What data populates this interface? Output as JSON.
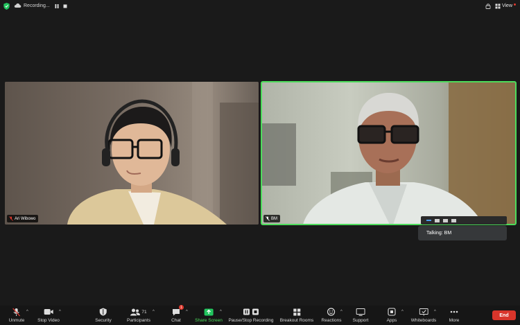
{
  "topbar": {
    "recording_label": "Recording...",
    "view_label": "View"
  },
  "participants": [
    {
      "name": "Ari Wibowo",
      "muted": true
    },
    {
      "name": "BM",
      "muted": true,
      "active_speaker": true
    }
  ],
  "talking": {
    "label": "Talking: BM"
  },
  "toolbar": {
    "unmute": "Unmute",
    "stop_video": "Stop Video",
    "security": "Security",
    "participants": "Participants",
    "participants_count": "71",
    "chat": "Chat",
    "chat_badge": "1",
    "share_screen": "Share Screen",
    "pause_stop_recording": "Pause/Stop Recording",
    "breakout_rooms": "Breakout Rooms",
    "reactions": "Reactions",
    "support": "Support",
    "apps": "Apps",
    "whiteboards": "Whiteboards",
    "more": "More",
    "end": "End"
  },
  "colors": {
    "active_speaker_border": "#4ddc5b",
    "end_button": "#d9352b",
    "share_screen": "#22c55e",
    "shield": "#22c55e"
  }
}
